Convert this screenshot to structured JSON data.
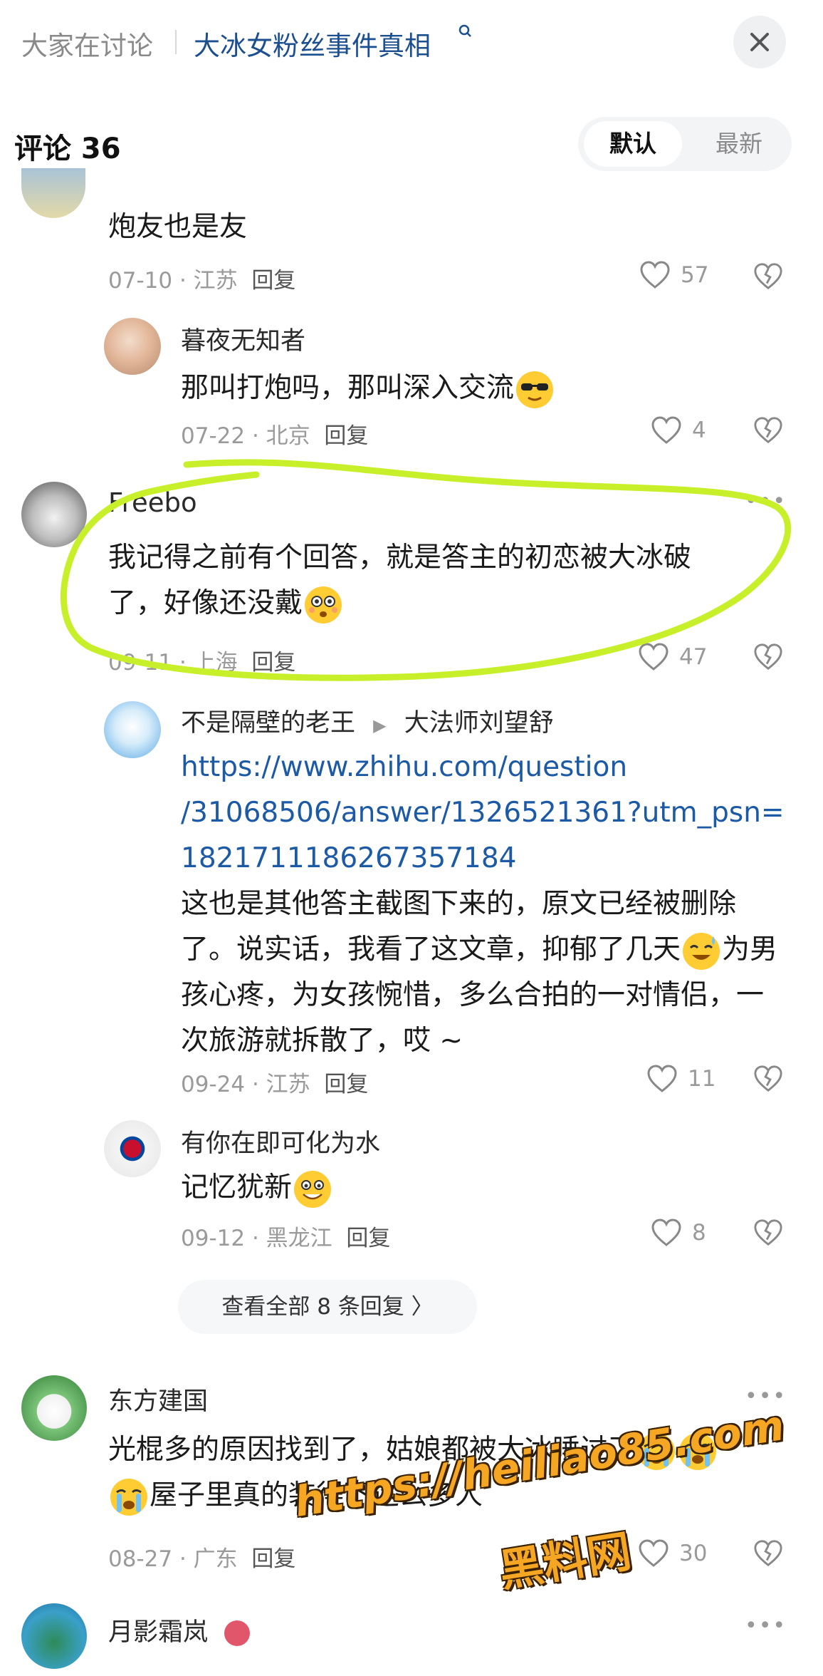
{
  "header": {
    "topic_prefix": "大家在讨论",
    "topic_title": "大冰女粉丝事件真相",
    "close_icon": "close-icon"
  },
  "comments_header": {
    "title": "评论 36",
    "sort_default": "默认",
    "sort_latest": "最新"
  },
  "comments": [
    {
      "text": "炮友也是友",
      "date": "07-10",
      "location": "江苏",
      "reply_label": "回复",
      "likes": "57"
    },
    {
      "user": "暮夜无知者",
      "text": "那叫打炮吗，那叫深入交流",
      "emoji": "sunglasses-emoji",
      "date": "07-22",
      "location": "北京",
      "reply_label": "回复",
      "likes": "4"
    },
    {
      "user": "Freebo",
      "text_line1": "我记得之前有个回答，就是答主的初恋被大冰破",
      "text_line2": "了，好像还没戴",
      "emoji": "flushed-emoji",
      "date": "09-11",
      "location": "上海",
      "reply_label": "回复",
      "likes": "47"
    },
    {
      "user": "不是隔壁的老王",
      "reply_to": "大法师刘望舒",
      "link_line1": "https://www.zhihu.com/question",
      "link_line2": "/31068506/answer/1326521361?utm_psn=",
      "link_line3": "1821711186267357184",
      "text_line1": "这也是其他答主截图下来的，原文已经被删除",
      "text_line2": "了。说实话，我看了这文章，抑郁了几天",
      "text_line2b": "为男",
      "text_line3": "孩心疼，为女孩惋惜，多么合拍的一对情侣，一",
      "text_line4": "次旅游就拆散了，哎 ~",
      "date": "09-24",
      "location": "江苏",
      "reply_label": "回复",
      "likes": "11"
    },
    {
      "user": "有你在即可化为水",
      "text": "记忆犹新",
      "date": "09-12",
      "location": "黑龙江",
      "reply_label": "回复",
      "likes": "8"
    },
    {
      "user": "东方建国",
      "text_line1": "光棍多的原因找到了，姑娘都被大冰睡过了",
      "text_line2": "屋子里真的装得下这么多人",
      "date": "08-27",
      "location": "广东",
      "reply_label": "回复",
      "likes": "30"
    },
    {
      "user": "月影霜岚"
    }
  ],
  "view_all": "查看全部 8 条回复 〉",
  "watermark": {
    "url": "https://heiliao85.com",
    "name": "黑料网"
  },
  "colors": {
    "highlight": "#c8f02a",
    "link": "#1c5aa6",
    "topic": "#1c4f8f",
    "watermark": "#f5a623"
  }
}
